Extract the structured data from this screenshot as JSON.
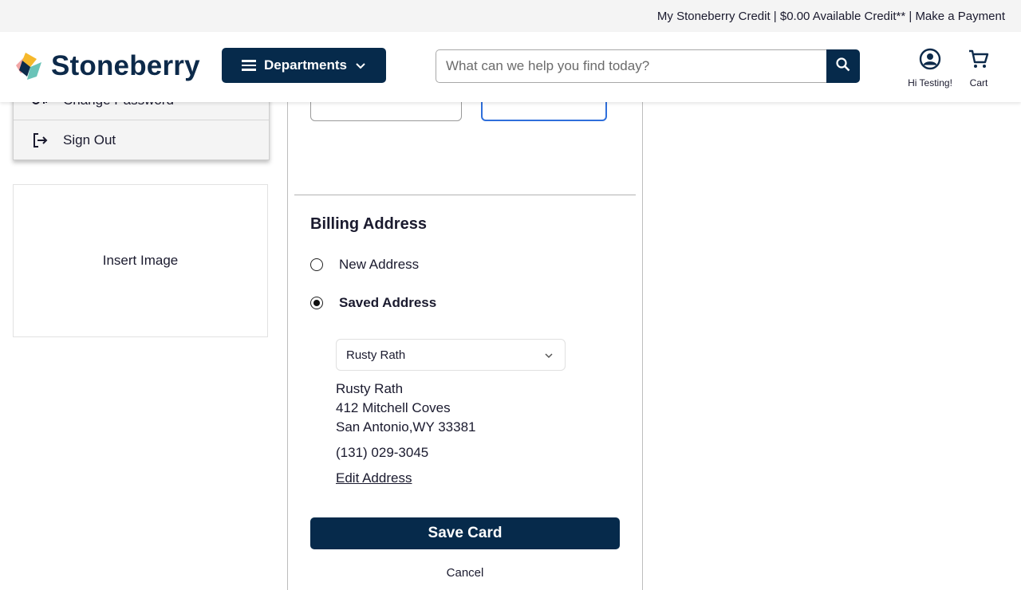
{
  "topbar": {
    "credit_link": "My Stoneberry Credit",
    "sep1": " | ",
    "available": "$0.00 Available Credit**",
    "sep2": " | ",
    "payment_link": "Make a Payment"
  },
  "header": {
    "logo_text": "Stoneberry",
    "departments_label": "Departments",
    "search_placeholder": "What can we help you find today?",
    "account_label": "Hi Testing!",
    "cart_label": "Cart"
  },
  "sidebar": {
    "items": [
      {
        "label": "Change Password",
        "icon": "key-icon"
      },
      {
        "label": "Sign Out",
        "icon": "sign-out-icon"
      }
    ],
    "image_placeholder": "Insert Image"
  },
  "billing": {
    "title": "Billing Address",
    "new_address_label": "New Address",
    "saved_address_label": "Saved Address",
    "selected_option": "saved",
    "saved_select_value": "Rusty Rath",
    "address": {
      "name": "Rusty Rath",
      "street": "412 Mitchell Coves",
      "city_line": "San Antonio,WY 33381",
      "phone": "(131) 029-3045"
    },
    "edit_link": "Edit Address"
  },
  "actions": {
    "save_label": "Save Card",
    "cancel_label": "Cancel"
  },
  "colors": {
    "primary": "#062a4b",
    "focus": "#2f6fdb",
    "topbar_bg": "#f4f4f4"
  }
}
